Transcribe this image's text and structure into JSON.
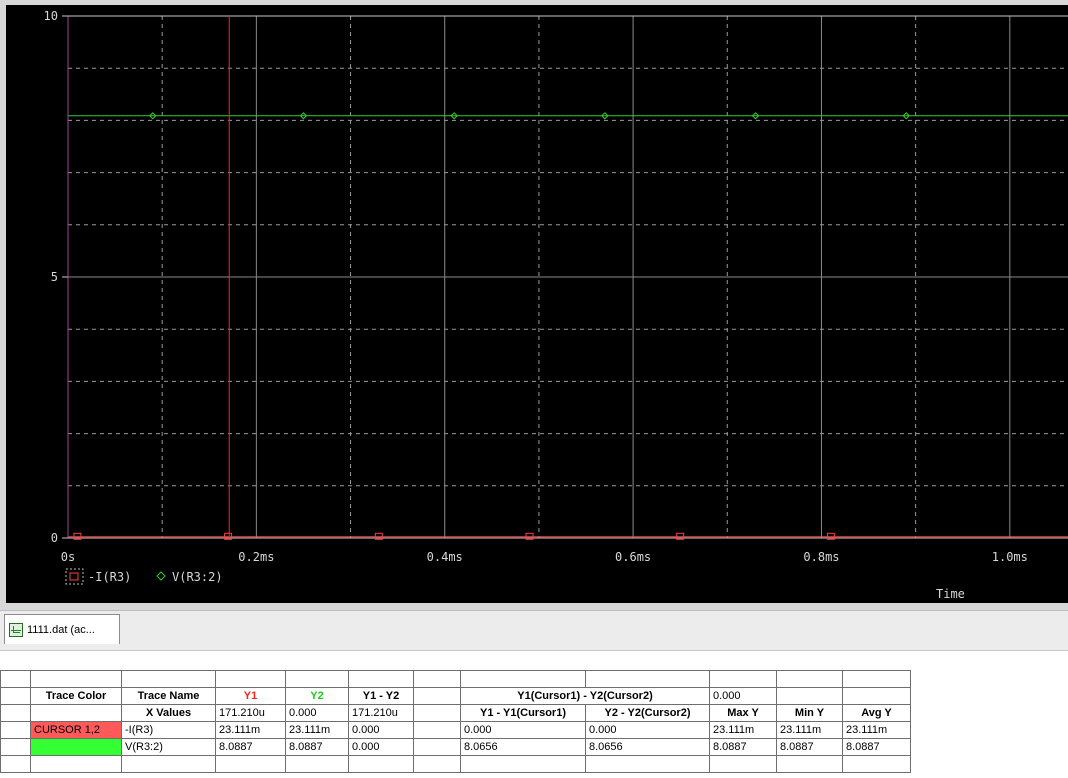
{
  "plot": {
    "x_axis_label": "Time",
    "x_ticks": [
      "0s",
      "0.2ms",
      "0.4ms",
      "0.6ms",
      "0.8ms",
      "1.0ms"
    ],
    "y_ticks": [
      "0",
      "5",
      "10"
    ],
    "legend": [
      {
        "symbol": "square-marker-icon",
        "label": "-I(R3)",
        "color": "#ff4040"
      },
      {
        "symbol": "diamond-marker-icon",
        "label": "V(R3:2)",
        "color": "#33cc33"
      }
    ],
    "cursor1_color": "#ff2020"
  },
  "chart_data": {
    "type": "line",
    "xlabel": "Time",
    "ylabel": "",
    "x_unit": "ms",
    "xlim": [
      0,
      1.1
    ],
    "ylim": [
      0,
      10
    ],
    "grid": true,
    "series": [
      {
        "name": "-I(R3)",
        "x": [
          0,
          1.1
        ],
        "values": [
          0.023111,
          0.023111
        ],
        "marker": "square",
        "color": "#ff4040"
      },
      {
        "name": "V(R3:2)",
        "x": [
          0,
          1.1
        ],
        "values": [
          8.0887,
          8.0887
        ],
        "marker": "diamond",
        "color": "#33cc33"
      }
    ],
    "cursor1_x": 0.17121
  },
  "tabs": [
    {
      "label": "1111.dat (ac..."
    }
  ],
  "probe_table": {
    "header": {
      "trace_color": "Trace Color",
      "trace_name": "Trace Name",
      "y1": "Y1",
      "y2": "Y2",
      "y1_minus_y2": "Y1 - Y2",
      "cursor_diff": "Y1(Cursor1) - Y2(Cursor2)",
      "cursor_diff_value": "0.000"
    },
    "xvalues_row": {
      "label": "X Values",
      "y1": "171.210u",
      "y2": "0.000",
      "y1_minus_y2": "171.210u",
      "y1_minus_cursor1": "Y1 - Y1(Cursor1)",
      "y2_minus_cursor2": "Y2 - Y2(Cursor2)",
      "max_y": "Max Y",
      "min_y": "Min Y",
      "avg_y": "Avg Y"
    },
    "rows": [
      {
        "color_label": "CURSOR 1,2",
        "name": "-I(R3)",
        "y1": "23.111m",
        "y2": "23.111m",
        "y1_minus_y2": "0.000",
        "c1": "0.000",
        "c2": "0.000",
        "max": "23.111m",
        "min": "23.111m",
        "avg": "23.111m"
      },
      {
        "color_label": "",
        "name": "V(R3:2)",
        "y1": "8.0887",
        "y2": "8.0887",
        "y1_minus_y2": "0.000",
        "c1": "8.0656",
        "c2": "8.0656",
        "max": "8.0887",
        "min": "8.0887",
        "avg": "8.0887"
      }
    ]
  }
}
